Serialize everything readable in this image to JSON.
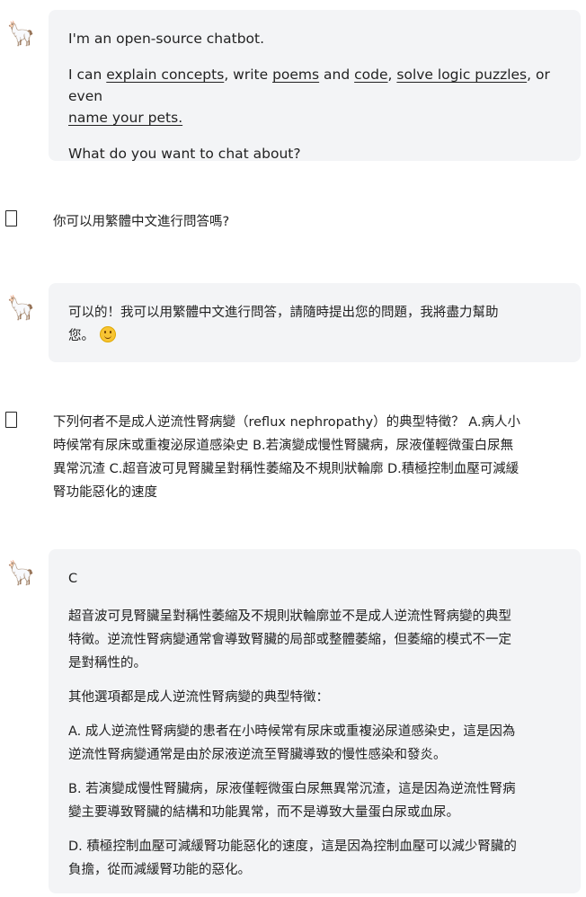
{
  "icons": {
    "bot_avatar": "llama-icon",
    "user_avatar": "user-placeholder-icon",
    "bot_glyph": "🦙"
  },
  "messages": [
    {
      "role": "bot",
      "intro": "I'm an open-source chatbot.",
      "line2": {
        "prefix": "I can ",
        "link1": "explain concepts",
        "sep1": ", write ",
        "link2": "poems",
        "sep2": " and ",
        "link3": "code",
        "sep3": ", ",
        "link4": "solve logic puzzles",
        "sep4": ", or even",
        "link5": "name your pets."
      },
      "question": "What do you want to chat about?"
    },
    {
      "role": "user",
      "text": "你可以用繁體中文進行問答嗎?"
    },
    {
      "role": "bot",
      "text_l1": "可以的！我可以用繁體中文進行問答，請隨時提出您的問題，我將盡力幫助",
      "text_l2": "您。"
    },
    {
      "role": "user",
      "lines": [
        "下列何者不是成人逆流性腎病變（reflux nephropathy）的典型特徵？ A.病人小",
        "時候常有尿床或重複泌尿道感染史 B.若演變成慢性腎臟病，尿液僅輕微蛋白尿無",
        "異常沉渣 C.超音波可見腎臟呈對稱性萎縮及不規則狀輪廓 D.積極控制血壓可減緩",
        "腎功能惡化的速度"
      ]
    },
    {
      "role": "bot",
      "answer": "C",
      "para1": [
        "超音波可見腎臟呈對稱性萎縮及不規則狀輪廓並不是成人逆流性腎病變的典型",
        "特徵。逆流性腎病變通常會導致腎臟的局部或整體萎縮，但萎縮的模式不一定",
        "是對稱性的。"
      ],
      "para2": "其他選項都是成人逆流性腎病變的典型特徵：",
      "paraA": [
        "A. 成人逆流性腎病變的患者在小時候常有尿床或重複泌尿道感染史，這是因為",
        "逆流性腎病變通常是由於尿液逆流至腎臟導致的慢性感染和發炎。"
      ],
      "paraB": [
        "B. 若演變成慢性腎臟病，尿液僅輕微蛋白尿無異常沉渣，這是因為逆流性腎病",
        "變主要導致腎臟的結構和功能異常，而不是導致大量蛋白尿或血尿。"
      ],
      "paraD": [
        "D. 積極控制血壓可減緩腎功能惡化的速度，這是因為控制血壓可以減少腎臟的",
        "負擔，從而減緩腎功能的惡化。"
      ]
    }
  ]
}
